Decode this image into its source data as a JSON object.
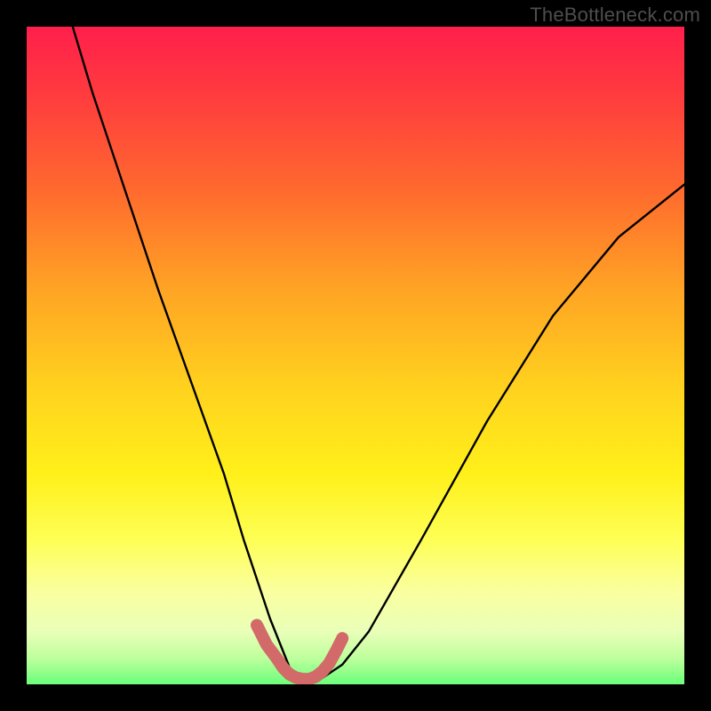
{
  "watermark": "TheBottleneck.com",
  "chart_data": {
    "type": "line",
    "title": "",
    "xlabel": "",
    "ylabel": "",
    "xlim": [
      0,
      100
    ],
    "ylim": [
      0,
      100
    ],
    "series": [
      {
        "name": "bottleneck-curve",
        "x": [
          7,
          10,
          15,
          20,
          25,
          30,
          33,
          35,
          37,
          39,
          40,
          42,
          43.5,
          45,
          48,
          52,
          60,
          70,
          80,
          90,
          100
        ],
        "y": [
          100,
          90,
          75,
          60,
          46,
          32,
          22,
          16,
          10,
          5,
          2.5,
          1,
          0.5,
          1,
          3,
          8,
          22,
          40,
          56,
          68,
          76
        ]
      }
    ],
    "highlight": {
      "name": "trough-highlight",
      "color": "#d36a6a",
      "x": [
        35,
        36.5,
        38,
        39,
        40,
        41,
        42,
        43,
        44,
        45,
        46,
        47,
        48
      ],
      "y": [
        9,
        6,
        4,
        2.5,
        1.5,
        1,
        0.8,
        0.8,
        1.2,
        2,
        3.2,
        5,
        7
      ]
    }
  }
}
